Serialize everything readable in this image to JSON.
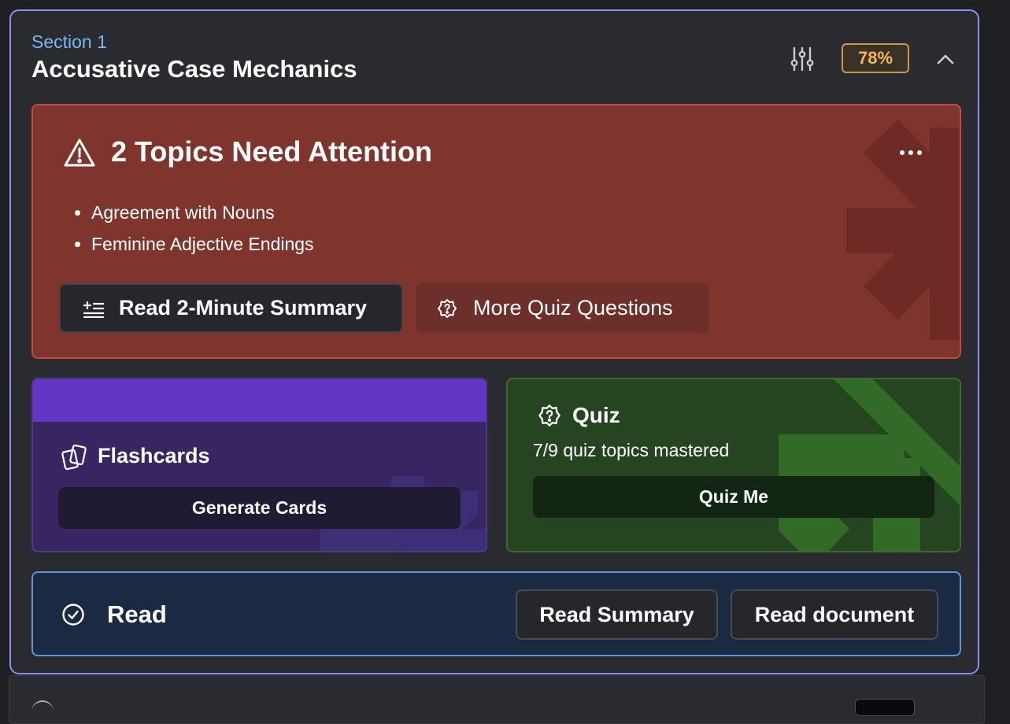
{
  "section": {
    "label": "Section 1",
    "title": "Accusative Case Mechanics",
    "progress_badge": "78%",
    "progress_value": 78
  },
  "attention": {
    "title": "2 Topics Need Attention",
    "topics": [
      "Agreement with Nouns",
      "Feminine Adjective Endings"
    ],
    "summary_button": "Read 2-Minute Summary",
    "quiz_button": "More Quiz Questions"
  },
  "flashcards": {
    "title": "Flashcards",
    "button": "Generate Cards"
  },
  "quiz": {
    "title": "Quiz",
    "subtitle": "7/9 quiz topics mastered",
    "mastered": 7,
    "total": 9,
    "button": "Quiz Me"
  },
  "read": {
    "title": "Read",
    "summary_button": "Read Summary",
    "document_button": "Read document"
  },
  "icons": {
    "settings": "sliders-icon",
    "collapse": "chevron-up-icon",
    "warning": "warning-triangle-icon",
    "more": "more-horizontal-icon",
    "summary": "list-icon",
    "quiz": "quiz-badge-icon",
    "flashcards": "cards-icon",
    "read": "check-circle-icon"
  },
  "colors": {
    "section_border": "#8b8ff0",
    "badge": "#f1b560",
    "attention_bg": "#7f342d",
    "flashcards_bg": "#372662",
    "flashcards_band": "#6434c2",
    "quiz_bg": "#24451f",
    "read_border": "#5f95d6"
  }
}
